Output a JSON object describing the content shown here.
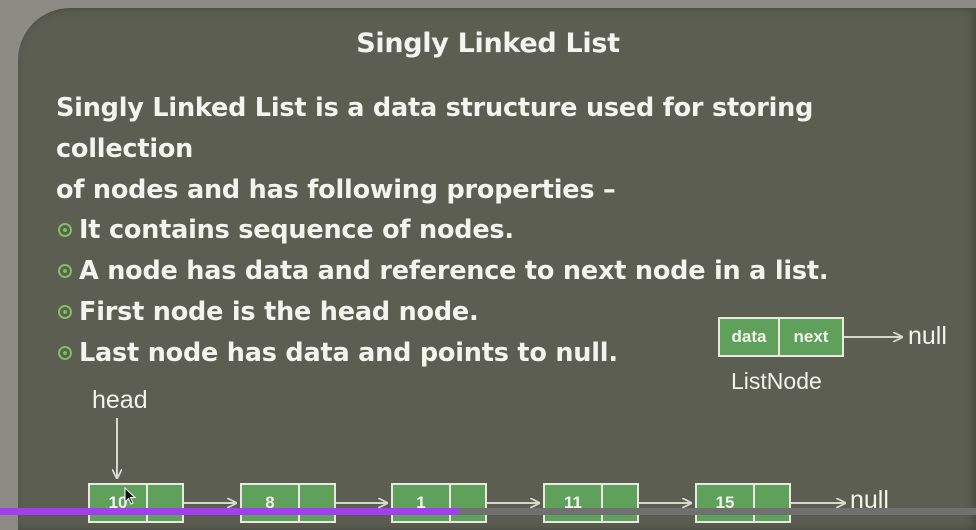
{
  "slide": {
    "title": "Singly Linked List",
    "intro_line1": "Singly Linked List is a data structure used for storing collection",
    "intro_line2": "of nodes and has following properties –",
    "bullets": [
      "It contains sequence of nodes.",
      "A node has data and reference to next node in a list.",
      "First node is the head node.",
      "Last node has data and points to null."
    ],
    "bullet_icon": "circle-bullet-icon",
    "legend": {
      "data_label": "data",
      "next_label": "next",
      "null_label": "null",
      "caption": "ListNode"
    },
    "list": {
      "head_label": "head",
      "nodes": [
        "10",
        "8",
        "1",
        "11",
        "15"
      ],
      "null_label": "null"
    }
  },
  "player": {
    "progress_fraction": 0.47
  },
  "colors": {
    "slide_bg": "#5b5e51",
    "node_fill": "#5fa05a",
    "bullet_green": "#7fbf62",
    "progress_purple": "#a23ff0"
  }
}
